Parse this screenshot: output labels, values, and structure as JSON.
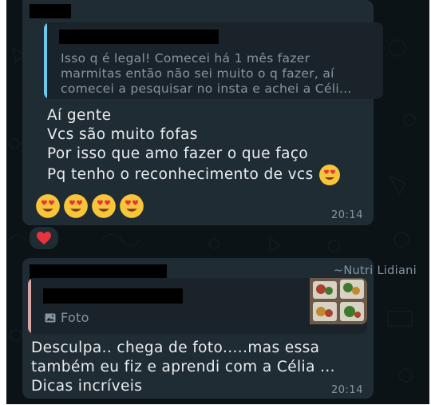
{
  "message1": {
    "quoted_text_lines": [
      "Isso q é legal! Comecei há 1 mês fazer",
      "marmitas então não sei muito o q fazer, aí",
      "comecei a pesquisar no insta e achei a Céli..."
    ],
    "body_lines": [
      "Aí gente",
      "Vcs são muito fofas",
      "Por isso que amo fazer o que faço",
      "Pq tenho o reconhecimento de vcs"
    ],
    "time": "20:14",
    "reaction": "heart"
  },
  "message2": {
    "sender": "~Nutri Lidiani",
    "quoted_label": "Foto",
    "body_lines": [
      "Desculpa.. chega de foto.....mas essa",
      "também eu fiz e aprendi com a Célia ...",
      "Dicas incríveis"
    ],
    "time": "20:14"
  },
  "colors": {
    "background": "#0c1317",
    "bubble": "#202c33",
    "quote_bg": "#1a2329",
    "quote_bar_1": "#6bcbef",
    "quote_bar_2": "#d9a6a8",
    "text": "#e9edef",
    "meta": "#8696a0"
  }
}
